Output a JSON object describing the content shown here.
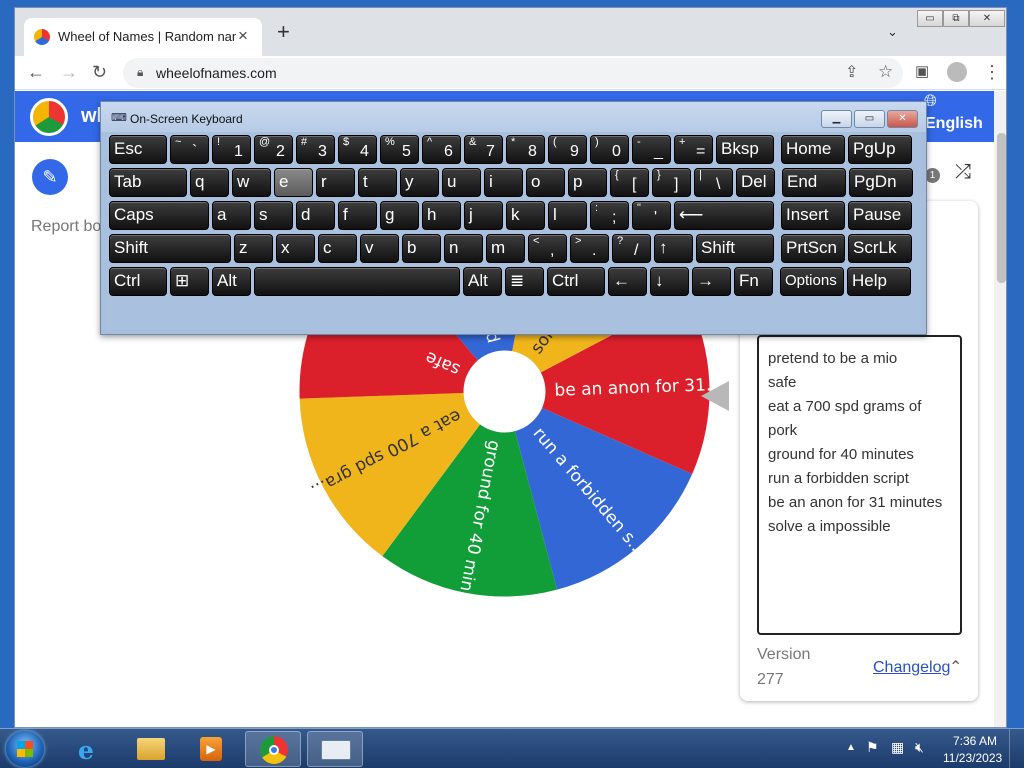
{
  "browser": {
    "tab_title": "Wheel of Names | Random name",
    "tab_close": "×",
    "new_tab": "+",
    "tab_search": "⌄",
    "url": "wheelofnames.com",
    "window_minimize": "▭",
    "window_restore": "⧉",
    "window_close": "✕"
  },
  "site": {
    "name": "wh",
    "language": "English",
    "report_text": "Report bo",
    "badge_count": "1"
  },
  "osk": {
    "title": "On-Screen Keyboard",
    "rows": [
      [
        {
          "l": "Esc"
        },
        {
          "s": "~",
          "l": "`"
        },
        {
          "s": "!",
          "l": "1"
        },
        {
          "s": "@",
          "l": "2"
        },
        {
          "s": "#",
          "l": "3"
        },
        {
          "s": "$",
          "l": "4"
        },
        {
          "s": "%",
          "l": "5"
        },
        {
          "s": "^",
          "l": "6"
        },
        {
          "s": "&",
          "l": "7"
        },
        {
          "s": "*",
          "l": "8"
        },
        {
          "s": "(",
          "l": "9"
        },
        {
          "s": ")",
          "l": "0"
        },
        {
          "s": "-",
          "l": "_"
        },
        {
          "s": "+",
          "l": "="
        },
        {
          "l": "Bksp"
        },
        {
          "l": "Home"
        },
        {
          "l": "PgUp"
        }
      ],
      [
        {
          "l": "Tab"
        },
        {
          "l": "q"
        },
        {
          "l": "w"
        },
        {
          "l": "e"
        },
        {
          "l": "r"
        },
        {
          "l": "t"
        },
        {
          "l": "y"
        },
        {
          "l": "u"
        },
        {
          "l": "i"
        },
        {
          "l": "o"
        },
        {
          "l": "p"
        },
        {
          "s": "{",
          "l": "["
        },
        {
          "s": "}",
          "l": "]"
        },
        {
          "s": "|",
          "l": "\\"
        },
        {
          "l": "Del"
        },
        {
          "l": "End"
        },
        {
          "l": "PgDn"
        }
      ],
      [
        {
          "l": "Caps"
        },
        {
          "l": "a"
        },
        {
          "l": "s"
        },
        {
          "l": "d"
        },
        {
          "l": "f"
        },
        {
          "l": "g"
        },
        {
          "l": "h"
        },
        {
          "l": "j"
        },
        {
          "l": "k"
        },
        {
          "l": "l"
        },
        {
          "s": ":",
          "l": ";"
        },
        {
          "s": "\"",
          "l": "'"
        },
        {
          "l": "⟵"
        },
        {
          "l": "Insert"
        },
        {
          "l": "Pause"
        }
      ],
      [
        {
          "l": "Shift"
        },
        {
          "l": "z"
        },
        {
          "l": "x"
        },
        {
          "l": "c"
        },
        {
          "l": "v"
        },
        {
          "l": "b"
        },
        {
          "l": "n"
        },
        {
          "l": "m"
        },
        {
          "s": "<",
          "l": ","
        },
        {
          "s": ">",
          "l": "."
        },
        {
          "s": "?",
          "l": "/"
        },
        {
          "l": "↑"
        },
        {
          "l": "Shift"
        },
        {
          "l": "PrtScn"
        },
        {
          "l": "ScrLk"
        }
      ],
      [
        {
          "l": "Ctrl"
        },
        {
          "l": "⊞"
        },
        {
          "l": "Alt"
        },
        {
          "l": ""
        },
        {
          "l": "Alt"
        },
        {
          "l": "≣"
        },
        {
          "l": "Ctrl"
        },
        {
          "l": "←"
        },
        {
          "l": "↓"
        },
        {
          "l": "→"
        },
        {
          "l": "Fn"
        },
        {
          "l": "Options"
        },
        {
          "l": "Help"
        }
      ]
    ]
  },
  "wheel": {
    "segments": [
      {
        "label": "be an anon for 31...",
        "color": "#db1f2b"
      },
      {
        "label": "run a forbidden s...",
        "color": "#3367d6"
      },
      {
        "label": "ground for 40 min...",
        "color": "#119e38"
      },
      {
        "label": "eat a 700 spd gra...",
        "color": "#f1b51c"
      },
      {
        "label": "safe",
        "color": "#db1f2b"
      },
      {
        "label": "pretend to be a mio",
        "color": "#3367d6"
      },
      {
        "label": "solve a impossible",
        "color": "#f1b51c"
      }
    ]
  },
  "entries": {
    "text": "pretend to be a mio\nsafe\neat a 700 spd grams of pork\nground for 40 minutes\nrun a forbidden script\nbe an anon for 31 minutes\nsolve a impossible",
    "version_label": "Version",
    "version_number": "277",
    "changelog": "Changelog"
  },
  "taskbar": {
    "clock_time": "7:36 AM",
    "clock_date": "11/23/2023"
  }
}
